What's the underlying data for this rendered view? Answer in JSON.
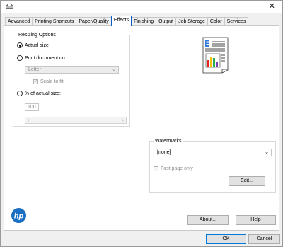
{
  "tabs": [
    "Advanced",
    "Printing Shortcuts",
    "Paper/Quality",
    "Effects",
    "Finishing",
    "Output",
    "Job Storage",
    "Color",
    "Services"
  ],
  "resizing": {
    "title": "Resizing Options",
    "actual_size": "Actual size",
    "print_on": "Print document on:",
    "paper": "Letter",
    "scale_to_fit": "Scale to fit",
    "pct_label": "% of actual size:",
    "pct_value": "100"
  },
  "watermarks": {
    "title": "Watermarks",
    "selected": "[none]",
    "first_page_only": "First page only",
    "edit": "Edit..."
  },
  "buttons": {
    "about": "About...",
    "help": "Help",
    "ok": "OK",
    "cancel": "Cancel"
  },
  "icons": {
    "close": "✕",
    "dropdown": "⌄",
    "slider_left": "‹",
    "slider_right": "›",
    "check": "✓"
  },
  "logo_text": "hp",
  "colors": {
    "tab_active_border": "#0a5cc9",
    "hp_blue": "#1a6fc3",
    "ok_border": "#0078d7"
  }
}
